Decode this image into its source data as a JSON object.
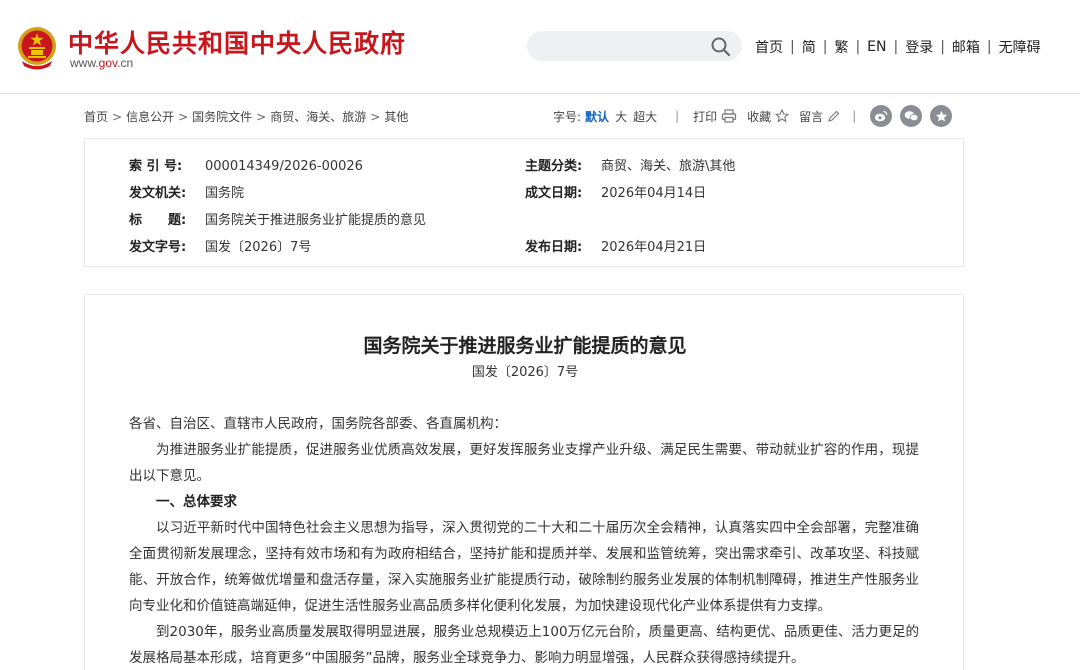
{
  "header": {
    "site_title": "中华人民共和国中央人民政府",
    "site_url_pre": "www.",
    "site_url_mid": "gov",
    "site_url_post": ".cn",
    "search_placeholder": "",
    "nav": [
      "首页",
      "简",
      "繁",
      "EN",
      "登录",
      "邮箱",
      "无障碍"
    ],
    "nav_separator": "|"
  },
  "breadcrumb": {
    "items": [
      "首页",
      "信息公开",
      "国务院文件",
      "商贸、海关、旅游",
      "其他"
    ],
    "separator": ">"
  },
  "toolbar": {
    "font_size_label": "字号:",
    "font_default": "默认",
    "font_large": "大",
    "font_xlarge": "超大",
    "print_label": "打印",
    "favorite_label": "收藏",
    "comment_label": "留言",
    "divider": "|"
  },
  "info": {
    "index_label": "索 引 号:",
    "index_value": "000014349/2026-00026",
    "topic_label": "主题分类:",
    "topic_value": "商贸、海关、旅游\\其他",
    "issuer_label": "发文机关:",
    "issuer_value": "国务院",
    "written_date_label": "成文日期:",
    "written_date_value": "2026年04月14日",
    "title_label": "标　　题:",
    "title_value": "国务院关于推进服务业扩能提质的意见",
    "doc_no_label": "发文字号:",
    "doc_no_value": "国发〔2026〕7号",
    "publish_date_label": "发布日期:",
    "publish_date_value": "2026年04月21日"
  },
  "article": {
    "title": "国务院关于推进服务业扩能提质的意见",
    "doc_no": "国发〔2026〕7号",
    "salutation": "各省、自治区、直辖市人民政府，国务院各部委、各直属机构：",
    "p1": "为推进服务业扩能提质，促进服务业优质高效发展，更好发挥服务业支撑产业升级、满足民生需要、带动就业扩容的作用，现提出以下意见。",
    "h1": "一、总体要求",
    "p2": "以习近平新时代中国特色社会主义思想为指导，深入贯彻党的二十大和二十届历次全会精神，认真落实四中全会部署，完整准确全面贯彻新发展理念，坚持有效市场和有为政府相结合，坚持扩能和提质并举、发展和监管统筹，突出需求牵引、改革攻坚、科技赋能、开放合作，统筹做优增量和盘活存量，深入实施服务业扩能提质行动，破除制约服务业发展的体制机制障碍，推进生产性服务业向专业化和价值链高端延伸，促进生活性服务业高品质多样化便利化发展，为加快建设现代化产业体系提供有力支撑。",
    "p3": "到2030年，服务业高质量发展取得明显进展，服务业总规模迈上100万亿元台阶，质量更高、结构更优、品质更佳、活力更足的发展格局基本形成，培育更多“中国服务”品牌，服务业全球竞争力、影响力明显增强，人民群众获得感持续提升。"
  },
  "colors": {
    "brand_red": "#c8161d",
    "active_blue": "#1565c0"
  }
}
